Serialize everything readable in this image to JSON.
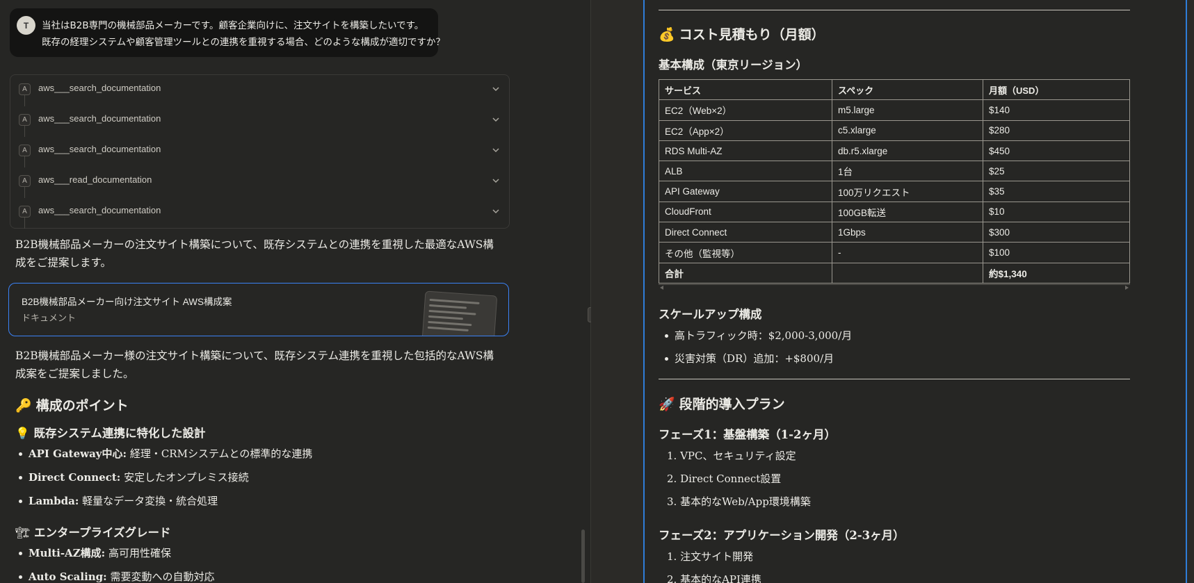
{
  "user": {
    "avatar": "T",
    "line1": "当社はB2B専門の機械部品メーカーです。顧客企業向けに、注文サイトを構築したいです。",
    "line2": "既存の経理システムや顧客管理ツールとの連携を重視する場合、どのような構成が適切ですか？"
  },
  "tools": [
    {
      "badge": "A",
      "name": "aws___search_documentation"
    },
    {
      "badge": "A",
      "name": "aws___search_documentation"
    },
    {
      "badge": "A",
      "name": "aws___search_documentation"
    },
    {
      "badge": "A",
      "name": "aws___read_documentation"
    },
    {
      "badge": "A",
      "name": "aws___search_documentation"
    }
  ],
  "intro": "B2B機械部品メーカーの注文サイト構築について、既存システムとの連携を重視した最適なAWS構成をご提案します。",
  "artifact": {
    "title": "B2B機械部品メーカー向け注文サイト AWS構成案",
    "subtitle": "ドキュメント"
  },
  "summary": "B2B機械部品メーカー様の注文サイト構築について、既存システム連携を重視した包括的なAWS構成案をご提案しました。",
  "points": {
    "heading_emoji": "🔑",
    "heading": "構成のポイント",
    "sub1_emoji": "💡",
    "sub1": "既存システム連携に特化した設計",
    "sub1_items": [
      {
        "bold": "API Gateway中心:",
        "text": " 経理・CRMシステムとの標準的な連携"
      },
      {
        "bold": "Direct Connect:",
        "text": " 安定したオンプレミス接続"
      },
      {
        "bold": "Lambda:",
        "text": " 軽量なデータ変換・統合処理"
      }
    ],
    "sub2_emoji": "🏗",
    "sub2": "エンタープライズグレード",
    "sub2_items": [
      {
        "bold": "Multi-AZ構成:",
        "text": " 高可用性確保"
      },
      {
        "bold": "Auto Scaling:",
        "text": " 需要変動への自動対応"
      }
    ]
  },
  "doc": {
    "cost_emoji": "💰",
    "cost_heading": "コスト見積もり（月額）",
    "base_heading": "基本構成（東京リージョン）",
    "table": {
      "headers": [
        "サービス",
        "スペック",
        "月額（USD）"
      ],
      "rows": [
        [
          "EC2（Web×2）",
          "m5.large",
          "$140"
        ],
        [
          "EC2（App×2）",
          "c5.xlarge",
          "$280"
        ],
        [
          "RDS Multi-AZ",
          "db.r5.xlarge",
          "$450"
        ],
        [
          "ALB",
          "1台",
          "$25"
        ],
        [
          "API Gateway",
          "100万リクエスト",
          "$35"
        ],
        [
          "CloudFront",
          "100GB転送",
          "$10"
        ],
        [
          "Direct Connect",
          "1Gbps",
          "$300"
        ],
        [
          "その他（監視等）",
          "-",
          "$100"
        ]
      ],
      "total": [
        "合計",
        "",
        "約$1,340"
      ]
    },
    "scale_heading": "スケールアップ構成",
    "scale_items": [
      "高トラフィック時：$2,000-3,000/月",
      "災害対策（DR）追加：+$800/月"
    ],
    "plan_emoji": "🚀",
    "plan_heading": "段階的導入プラン",
    "phase1": "フェーズ1：基盤構築（1-2ヶ月）",
    "phase1_items": [
      "1. VPC、セキュリティ設定",
      "2. Direct Connect設置",
      "3. 基本的なWeb/App環境構築"
    ],
    "phase2": "フェーズ2：アプリケーション開発（2-3ヶ月）",
    "phase2_items": [
      "1. 注文サイト開発",
      "2. 基本的なAPI連携"
    ]
  }
}
